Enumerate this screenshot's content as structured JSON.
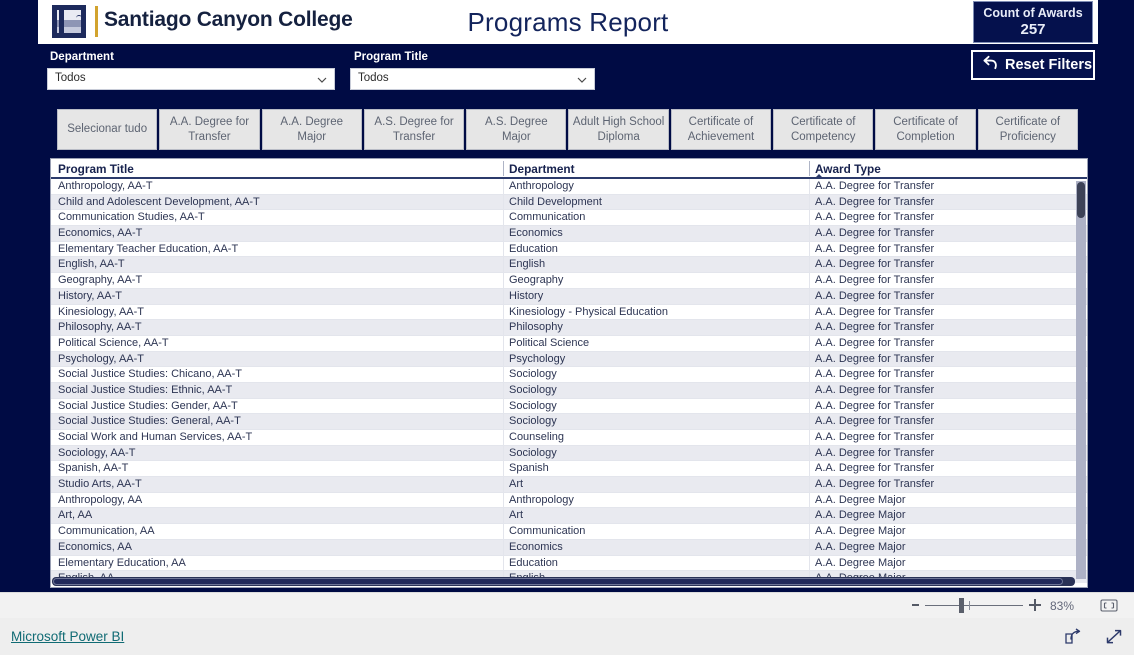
{
  "header": {
    "college_name": "Santiago Canyon College",
    "report_title": "Programs Report",
    "logo_icon": "college-seal-icon",
    "count_card": {
      "label": "Count of Awards",
      "value": "257"
    }
  },
  "filters": {
    "department": {
      "label": "Department",
      "value": "Todos",
      "chevron_icon": "chevron-down-icon"
    },
    "program_title": {
      "label": "Program Title",
      "value": "Todos",
      "chevron_icon": "chevron-down-icon"
    },
    "reset": {
      "label": "Reset Filters",
      "icon": "undo-arrow-icon"
    }
  },
  "award_type_tabs": [
    "Selecionar tudo",
    "A.A. Degree for Transfer",
    "A.A. Degree Major",
    "A.S. Degree for Transfer",
    "A.S. Degree Major",
    "Adult High School Diploma",
    "Certificate of Achievement",
    "Certificate of Competency",
    "Certificate of Completion",
    "Certificate of Proficiency"
  ],
  "table": {
    "columns": [
      "Program Title",
      "Department",
      "Award Type"
    ],
    "sorted_column": "Award Type",
    "sort_direction": "ascending",
    "rows": [
      [
        "Anthropology, AA-T",
        "Anthropology",
        "A.A. Degree for Transfer"
      ],
      [
        "Child and Adolescent Development, AA-T",
        "Child Development",
        "A.A. Degree for Transfer"
      ],
      [
        "Communication Studies, AA-T",
        "Communication",
        "A.A. Degree for Transfer"
      ],
      [
        "Economics, AA-T",
        "Economics",
        "A.A. Degree for Transfer"
      ],
      [
        "Elementary Teacher Education, AA-T",
        "Education",
        "A.A. Degree for Transfer"
      ],
      [
        "English, AA-T",
        "English",
        "A.A. Degree for Transfer"
      ],
      [
        "Geography, AA-T",
        "Geography",
        "A.A. Degree for Transfer"
      ],
      [
        "History, AA-T",
        "History",
        "A.A. Degree for Transfer"
      ],
      [
        "Kinesiology, AA-T",
        "Kinesiology - Physical Education",
        "A.A. Degree for Transfer"
      ],
      [
        "Philosophy, AA-T",
        "Philosophy",
        "A.A. Degree for Transfer"
      ],
      [
        "Political Science, AA-T",
        "Political Science",
        "A.A. Degree for Transfer"
      ],
      [
        "Psychology, AA-T",
        "Psychology",
        "A.A. Degree for Transfer"
      ],
      [
        "Social Justice Studies: Chicano, AA-T",
        "Sociology",
        "A.A. Degree for Transfer"
      ],
      [
        "Social Justice Studies: Ethnic, AA-T",
        "Sociology",
        "A.A. Degree for Transfer"
      ],
      [
        "Social Justice Studies: Gender, AA-T",
        "Sociology",
        "A.A. Degree for Transfer"
      ],
      [
        "Social Justice Studies: General, AA-T",
        "Sociology",
        "A.A. Degree for Transfer"
      ],
      [
        "Social Work and Human Services, AA-T",
        "Counseling",
        "A.A. Degree for Transfer"
      ],
      [
        "Sociology, AA-T",
        "Sociology",
        "A.A. Degree for Transfer"
      ],
      [
        "Spanish, AA-T",
        "Spanish",
        "A.A. Degree for Transfer"
      ],
      [
        "Studio Arts, AA-T",
        "Art",
        "A.A. Degree for Transfer"
      ],
      [
        "Anthropology, AA",
        "Anthropology",
        "A.A. Degree Major"
      ],
      [
        "Art, AA",
        "Art",
        "A.A. Degree Major"
      ],
      [
        "Communication, AA",
        "Communication",
        "A.A. Degree Major"
      ],
      [
        "Economics, AA",
        "Economics",
        "A.A. Degree Major"
      ],
      [
        "Elementary Education, AA",
        "Education",
        "A.A. Degree Major"
      ],
      [
        "English, AA",
        "English",
        "A.A. Degree Major"
      ]
    ]
  },
  "footer": {
    "zoom_level": "83%",
    "zoom_out_icon": "minus-icon",
    "zoom_in_icon": "plus-icon",
    "fit_to_page_icon": "fit-to-page-icon",
    "powerbi_link": "Microsoft Power BI",
    "share_icon": "share-icon",
    "fullscreen_icon": "fullscreen-icon"
  },
  "colors": {
    "brand_navy": "#000b44",
    "accent_gold": "#d2a32e",
    "title_blue": "#13245c",
    "link_teal": "#106b74",
    "row_alt": "#e9eaf0"
  }
}
